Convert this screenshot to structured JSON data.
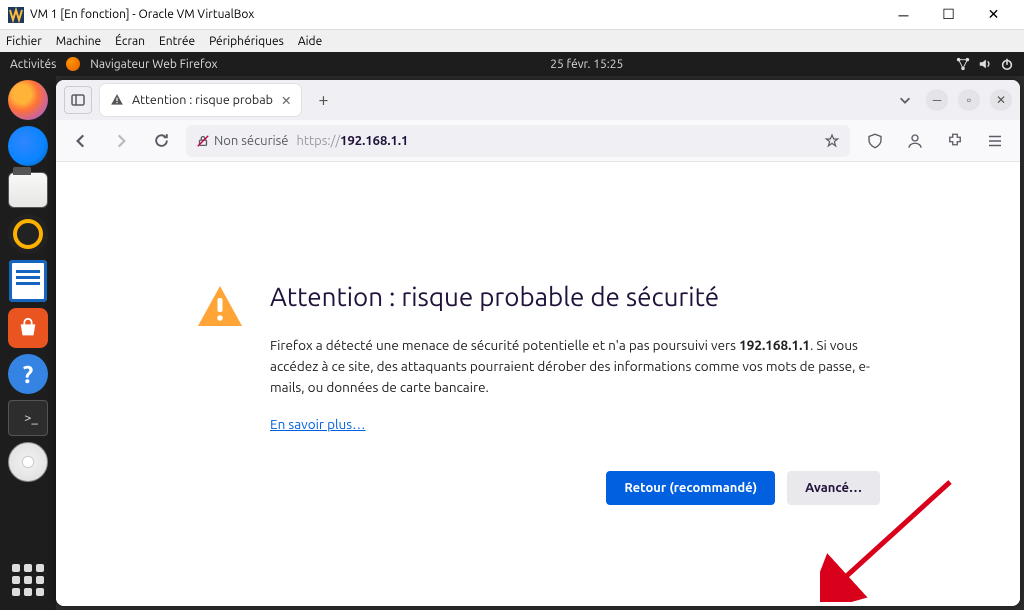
{
  "window": {
    "title": "VM 1 [En fonction] - Oracle VM VirtualBox"
  },
  "vbox_menu": {
    "file": "Fichier",
    "machine": "Machine",
    "screen": "Écran",
    "input": "Entrée",
    "devices": "Périphériques",
    "help": "Aide"
  },
  "ubuntu_top": {
    "activities": "Activités",
    "app_name": "Navigateur Web Firefox",
    "datetime": "25 févr.  15:25"
  },
  "firefox": {
    "tab_title": "Attention : risque probab",
    "security_label": "Non sécurisé",
    "url_scheme": "https://",
    "url_host": "192.168.1.1"
  },
  "error": {
    "heading": "Attention : risque probable de sécurité",
    "body_before": "Firefox a détecté une menace de sécurité potentielle et n'a pas poursuivi vers ",
    "body_host": "192.168.1.1",
    "body_after": ". Si vous accédez à ce site, des attaquants pourraient dérober des informations comme vos mots de passe, e-mails, ou données de carte bancaire.",
    "learn_more": "En savoir plus…",
    "btn_back": "Retour (recommandé)",
    "btn_advanced": "Avancé…"
  }
}
